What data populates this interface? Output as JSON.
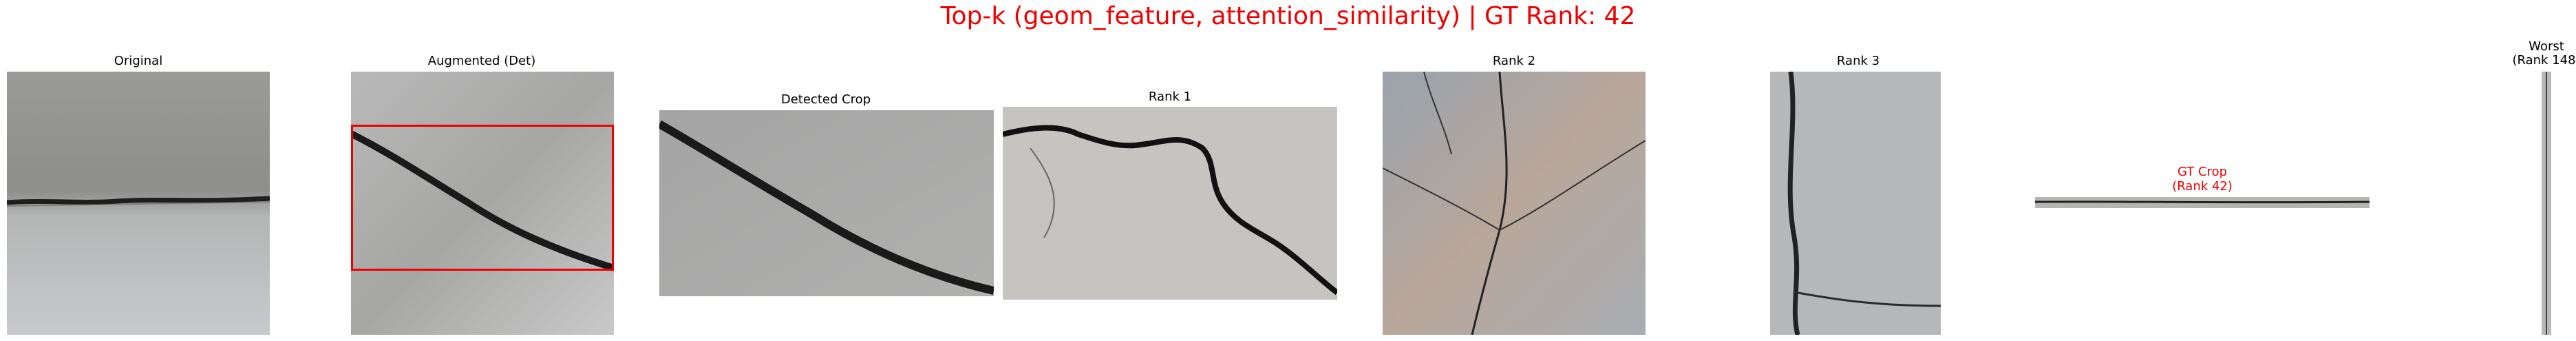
{
  "figure": {
    "title": "Top-k (geom_feature, attention_similarity) | GT Rank: 42",
    "title_color": "#ee0000"
  },
  "panels": {
    "original": {
      "label": "Original"
    },
    "augmented": {
      "label": "Augmented (Det)",
      "bbox_color": "#ee0000"
    },
    "detected_crop": {
      "label": "Detected Crop"
    },
    "rank1": {
      "label": "Rank 1"
    },
    "rank2": {
      "label": "Rank 2"
    },
    "rank3": {
      "label": "Rank 3"
    },
    "gt_crop": {
      "label_line1": "GT Crop",
      "label_line2": "(Rank 42)",
      "label_color": "#ee0000"
    },
    "worst": {
      "label_line1": "Worst",
      "label_line2": "(Rank 148)"
    }
  }
}
